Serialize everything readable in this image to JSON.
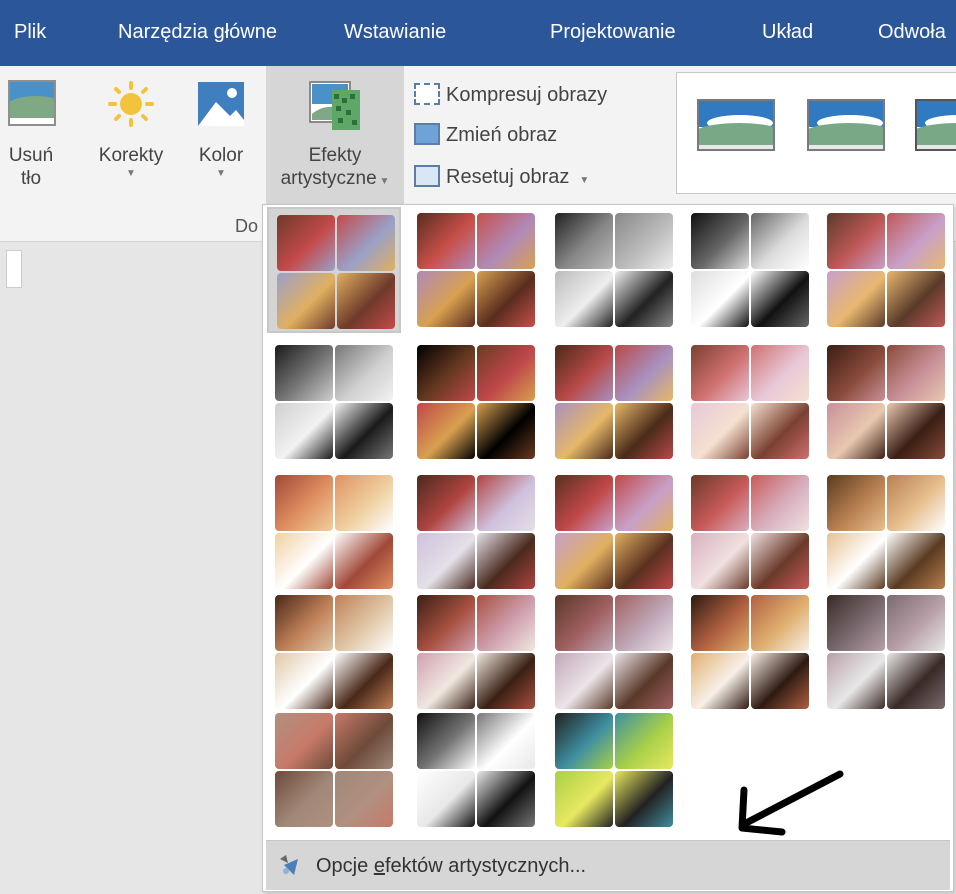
{
  "tabs": [
    "Plik",
    "Narzędzia główne",
    "Wstawianie",
    "Projektowanie",
    "Układ",
    "Odwoła"
  ],
  "ribbon": {
    "remove_bg": [
      "Usuń",
      "tło"
    ],
    "corrections": "Korekty",
    "color": "Kolor",
    "artistic_effects": [
      "Efekty",
      "artystyczne"
    ],
    "small_buttons": [
      "Kompresuj obrazy",
      "Zmień obraz",
      "Resetuj obraz"
    ],
    "group_label": "Do"
  },
  "dropdown": {
    "footer_prefix": "Opcje ",
    "footer_access_key": "e",
    "footer_suffix": "fektów artystycznych..."
  },
  "colors": {
    "tab_bar": "#2b579a",
    "ribbon_bg": "#f3f3f3",
    "selected_bg": "#d6d6d6"
  },
  "icons": [
    "remove-background-icon",
    "corrections-sun-icon",
    "color-picture-icon",
    "artistic-effects-icon",
    "compress-pictures-icon",
    "change-picture-icon",
    "reset-picture-icon",
    "artistic-effects-options-icon"
  ]
}
